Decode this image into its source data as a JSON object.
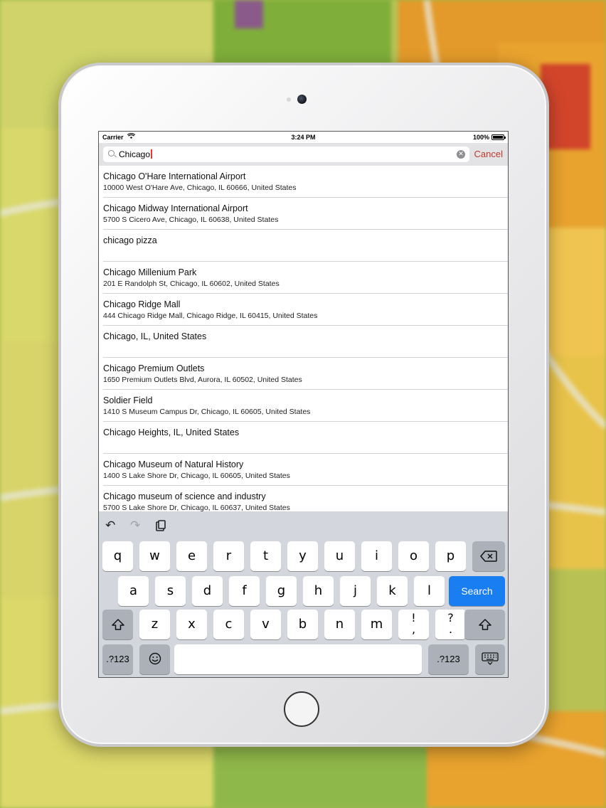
{
  "status_bar": {
    "carrier": "Carrier",
    "time": "3:24 PM",
    "battery": "100%"
  },
  "search": {
    "query": "Chicago",
    "cancel_label": "Cancel"
  },
  "results": [
    {
      "title": "Chicago O'Hare International Airport",
      "subtitle": "10000 West O'Hare Ave, Chicago, IL  60666, United States"
    },
    {
      "title": "Chicago Midway International Airport",
      "subtitle": "5700 S Cicero Ave, Chicago, IL 60638, United States"
    },
    {
      "title": "chicago pizza",
      "subtitle": ""
    },
    {
      "title": "Chicago Millenium Park",
      "subtitle": "201 E Randolph St, Chicago, IL  60602, United States"
    },
    {
      "title": "Chicago Ridge Mall",
      "subtitle": "444 Chicago Ridge Mall, Chicago Ridge, IL  60415, United States"
    },
    {
      "title": "Chicago, IL, United States",
      "subtitle": ""
    },
    {
      "title": "Chicago Premium Outlets",
      "subtitle": "1650 Premium Outlets Blvd, Aurora, IL  60502, United States"
    },
    {
      "title": "Soldier Field",
      "subtitle": "1410 S Museum Campus Dr, Chicago, IL 60605, United States"
    },
    {
      "title": "Chicago Heights, IL, United States",
      "subtitle": ""
    },
    {
      "title": "Chicago Museum of Natural History",
      "subtitle": "1400 S Lake Shore Dr, Chicago, IL  60605, United States"
    },
    {
      "title": "Chicago museum of science and industry",
      "subtitle": "5700 S Lake Shore Dr, Chicago, IL  60637, United States"
    }
  ],
  "keyboard": {
    "row1": [
      "q",
      "w",
      "e",
      "r",
      "t",
      "y",
      "u",
      "i",
      "o",
      "p"
    ],
    "row2": [
      "a",
      "s",
      "d",
      "f",
      "g",
      "h",
      "j",
      "k",
      "l"
    ],
    "row3": [
      "z",
      "x",
      "c",
      "v",
      "b",
      "n",
      "m"
    ],
    "punct1": {
      "top": "!",
      "bottom": ","
    },
    "punct2": {
      "top": "?",
      "bottom": "."
    },
    "search_label": "Search",
    "numbers_label": ".?123",
    "icons": {
      "backspace": "backspace-icon",
      "shift": "shift-icon",
      "emoji": "emoji-icon",
      "hide_keyboard": "keyboard-icon",
      "undo": "undo-icon",
      "redo": "redo-icon",
      "paste": "paste-icon"
    }
  },
  "colors": {
    "accent": "#1a7ef3",
    "cancel": "#c0392b"
  }
}
